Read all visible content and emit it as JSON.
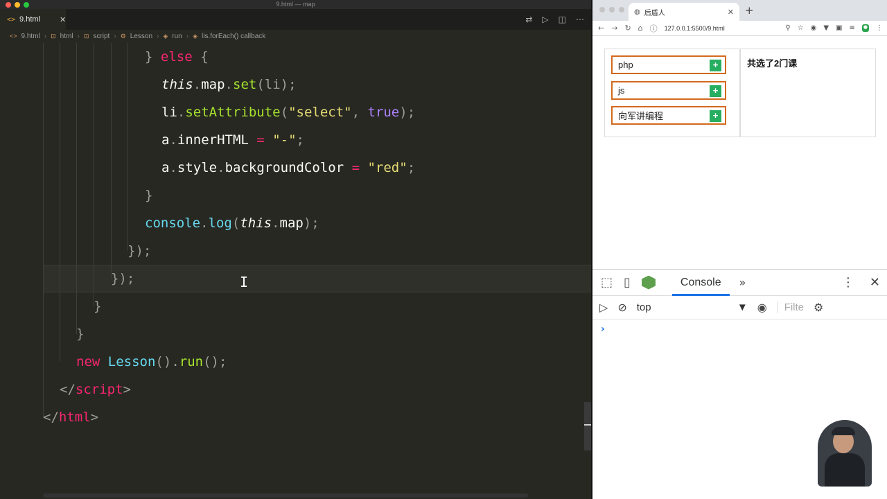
{
  "window": {
    "title": "9.html — map"
  },
  "editor": {
    "tab": {
      "name": "9.html",
      "close": "✕"
    },
    "breadcrumb": [
      "9.html",
      "html",
      "script",
      "Lesson",
      "run",
      "lis.forEach() callback"
    ],
    "code": {
      "l1": {
        "brace": "} ",
        "kw": "else",
        "rest": " {"
      },
      "l2": {
        "this": "this",
        "d1": ".",
        "obj": "map",
        "d2": ".",
        "m": "set",
        "rest": "(li);"
      },
      "l3": {
        "obj": "li",
        "d": ".",
        "m": "setAttribute",
        "p1": "(",
        "s": "\"select\"",
        "c": ", ",
        "b": "true",
        "p2": ");"
      },
      "l4": {
        "obj": "a",
        "d": ".",
        "prop": "innerHTML",
        "eq": " = ",
        "s": "\"-\"",
        "end": ";"
      },
      "l5": {
        "obj": "a",
        "d1": ".",
        "p1": "style",
        "d2": ".",
        "p2": "backgroundColor",
        "eq": " = ",
        "s": "\"red\"",
        "end": ";"
      },
      "l6": "}",
      "l7": {
        "obj": "console",
        "d": ".",
        "m": "log",
        "p1": "(",
        "this": "this",
        "d2": ".",
        "prop": "map",
        "end": ");"
      },
      "l8": "});",
      "l9": "});",
      "l10": "}",
      "l11": "}",
      "l12": {
        "kw": "new",
        "cls": "Lesson",
        "p": "()",
        "d": ".",
        "m": "run",
        "end": "();"
      },
      "l13": {
        "open": "</",
        "tag": "script",
        "close": ">"
      },
      "l14": {
        "open": "</",
        "tag": "html",
        "close": ">"
      }
    }
  },
  "browser": {
    "tab_title": "后盾人",
    "url": "127.0.0.1:5500/9.html",
    "lessons": [
      {
        "name": "php",
        "action": "+"
      },
      {
        "name": "js",
        "action": "+"
      },
      {
        "name": "向军讲编程",
        "action": "+"
      }
    ],
    "summary": "共选了2门课"
  },
  "devtools": {
    "active_tab": "Console",
    "context": "top",
    "filter_placeholder": "Filte",
    "prompt": "›"
  },
  "colors": {
    "keyword": "#f92672",
    "string": "#e6db74",
    "function": "#a6e22e",
    "lesson_border": "#d2691e",
    "add_button": "#27ae60"
  }
}
